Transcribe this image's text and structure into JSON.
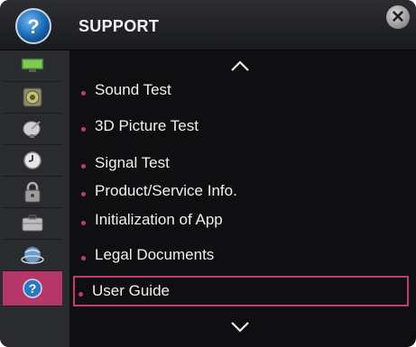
{
  "header": {
    "title": "SUPPORT",
    "icon": "help-icon",
    "close_icon": "close-icon"
  },
  "sidebar": {
    "items": [
      {
        "name": "picture",
        "icon": "picture-icon"
      },
      {
        "name": "sound",
        "icon": "sound-icon"
      },
      {
        "name": "channel",
        "icon": "satellite-icon"
      },
      {
        "name": "time",
        "icon": "clock-icon"
      },
      {
        "name": "lock",
        "icon": "lock-icon"
      },
      {
        "name": "option",
        "icon": "option-icon"
      },
      {
        "name": "network",
        "icon": "network-icon"
      },
      {
        "name": "support",
        "icon": "help-icon",
        "active": true
      }
    ]
  },
  "list": {
    "items": [
      {
        "label": "Sound Test"
      },
      {
        "label": "3D Picture Test"
      },
      {
        "label": "Signal Test"
      },
      {
        "label": "Product/Service Info."
      },
      {
        "label": "Initialization of App"
      },
      {
        "label": "Legal Documents"
      },
      {
        "label": "User Guide",
        "selected": true
      }
    ],
    "scroll_up_icon": "chevron-up-icon",
    "scroll_down_icon": "chevron-down-icon"
  },
  "colors": {
    "accent": "#c23a6e",
    "background": "#0f0f11",
    "sidebar": "#2a2b2e",
    "text": "#f0f0f0"
  }
}
